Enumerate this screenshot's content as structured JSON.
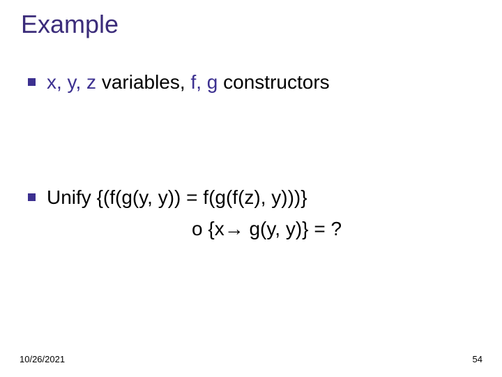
{
  "title": "Example",
  "bullets": {
    "first": {
      "seg1": "x, y, z",
      "seg2": " variables, ",
      "seg3": "f, g",
      "seg4": " constructors"
    },
    "second": {
      "line1": "Unify {(f(g(y, y)) = f(g(f(z), y)))}",
      "line2": "o {x→ g(y, y)} = ?"
    }
  },
  "footer": {
    "date": "10/26/2021",
    "page": "54"
  }
}
